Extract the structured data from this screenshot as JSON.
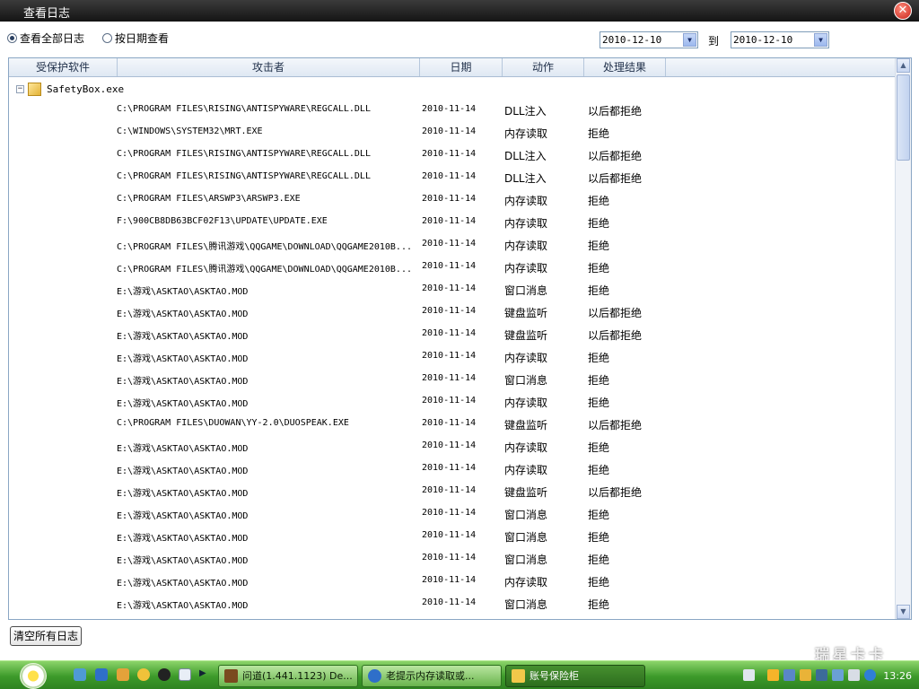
{
  "window": {
    "title": "查看日志"
  },
  "filter": {
    "view_all_label": "查看全部日志",
    "by_date_label": "按日期查看",
    "selected": "view_all",
    "date_from": "2010-12-10",
    "to_label": "到",
    "date_to": "2010-12-10"
  },
  "grid": {
    "columns": [
      "受保护软件",
      "攻击者",
      "日期",
      "动作",
      "处理结果"
    ],
    "group": {
      "name": "SafetyBox.exe",
      "toggle": "−"
    },
    "rows": [
      {
        "attacker": "C:\\PROGRAM FILES\\RISING\\ANTISPYWARE\\REGCALL.DLL",
        "date": "2010-11-14",
        "action": "DLL注入",
        "result": "以后都拒绝"
      },
      {
        "attacker": "C:\\WINDOWS\\SYSTEM32\\MRT.EXE",
        "date": "2010-11-14",
        "action": "内存读取",
        "result": "拒绝"
      },
      {
        "attacker": "C:\\PROGRAM FILES\\RISING\\ANTISPYWARE\\REGCALL.DLL",
        "date": "2010-11-14",
        "action": "DLL注入",
        "result": "以后都拒绝"
      },
      {
        "attacker": "C:\\PROGRAM FILES\\RISING\\ANTISPYWARE\\REGCALL.DLL",
        "date": "2010-11-14",
        "action": "DLL注入",
        "result": "以后都拒绝"
      },
      {
        "attacker": "C:\\PROGRAM FILES\\ARSWP3\\ARSWP3.EXE",
        "date": "2010-11-14",
        "action": "内存读取",
        "result": "拒绝"
      },
      {
        "attacker": "F:\\900CB8DB63BCF02F13\\UPDATE\\UPDATE.EXE",
        "date": "2010-11-14",
        "action": "内存读取",
        "result": "拒绝"
      },
      {
        "attacker": "C:\\PROGRAM FILES\\腾讯游戏\\QQGAME\\DOWNLOAD\\QQGAME2010B...",
        "date": "2010-11-14",
        "action": "内存读取",
        "result": "拒绝"
      },
      {
        "attacker": "C:\\PROGRAM FILES\\腾讯游戏\\QQGAME\\DOWNLOAD\\QQGAME2010B...",
        "date": "2010-11-14",
        "action": "内存读取",
        "result": "拒绝"
      },
      {
        "attacker": "E:\\游戏\\ASKTAO\\ASKTAO.MOD",
        "date": "2010-11-14",
        "action": "窗口消息",
        "result": "拒绝"
      },
      {
        "attacker": "E:\\游戏\\ASKTAO\\ASKTAO.MOD",
        "date": "2010-11-14",
        "action": "键盘监听",
        "result": "以后都拒绝"
      },
      {
        "attacker": "E:\\游戏\\ASKTAO\\ASKTAO.MOD",
        "date": "2010-11-14",
        "action": "键盘监听",
        "result": "以后都拒绝"
      },
      {
        "attacker": "E:\\游戏\\ASKTAO\\ASKTAO.MOD",
        "date": "2010-11-14",
        "action": "内存读取",
        "result": "拒绝"
      },
      {
        "attacker": "E:\\游戏\\ASKTAO\\ASKTAO.MOD",
        "date": "2010-11-14",
        "action": "窗口消息",
        "result": "拒绝"
      },
      {
        "attacker": "E:\\游戏\\ASKTAO\\ASKTAO.MOD",
        "date": "2010-11-14",
        "action": "内存读取",
        "result": "拒绝"
      },
      {
        "attacker": "C:\\PROGRAM FILES\\DUOWAN\\YY-2.0\\DUOSPEAK.EXE",
        "date": "2010-11-14",
        "action": "键盘监听",
        "result": "以后都拒绝"
      },
      {
        "attacker": "E:\\游戏\\ASKTAO\\ASKTAO.MOD",
        "date": "2010-11-14",
        "action": "内存读取",
        "result": "拒绝"
      },
      {
        "attacker": "E:\\游戏\\ASKTAO\\ASKTAO.MOD",
        "date": "2010-11-14",
        "action": "内存读取",
        "result": "拒绝"
      },
      {
        "attacker": "E:\\游戏\\ASKTAO\\ASKTAO.MOD",
        "date": "2010-11-14",
        "action": "键盘监听",
        "result": "以后都拒绝"
      },
      {
        "attacker": "E:\\游戏\\ASKTAO\\ASKTAO.MOD",
        "date": "2010-11-14",
        "action": "窗口消息",
        "result": "拒绝"
      },
      {
        "attacker": "E:\\游戏\\ASKTAO\\ASKTAO.MOD",
        "date": "2010-11-14",
        "action": "窗口消息",
        "result": "拒绝"
      },
      {
        "attacker": "E:\\游戏\\ASKTAO\\ASKTAO.MOD",
        "date": "2010-11-14",
        "action": "窗口消息",
        "result": "拒绝"
      },
      {
        "attacker": "E:\\游戏\\ASKTAO\\ASKTAO.MOD",
        "date": "2010-11-14",
        "action": "内存读取",
        "result": "拒绝"
      },
      {
        "attacker": "E:\\游戏\\ASKTAO\\ASKTAO.MOD",
        "date": "2010-11-14",
        "action": "窗口消息",
        "result": "拒绝"
      }
    ]
  },
  "actions": {
    "clear_all_label": "清空所有日志"
  },
  "taskbar": {
    "tasks": [
      {
        "label": "问道(1.441.1123) De...",
        "icon": "game-icon",
        "active": false
      },
      {
        "label": "老提示内存读取或...",
        "icon": "ie-icon",
        "active": false
      },
      {
        "label": "账号保险柜",
        "icon": "safe-icon",
        "active": true
      }
    ],
    "clock": "13:26"
  },
  "watermark": "瑞星卡卡",
  "colors": {
    "titlebar": "#1e1e1e",
    "taskbar": "#3d9a2a",
    "grid_border": "#8aa6c4"
  }
}
